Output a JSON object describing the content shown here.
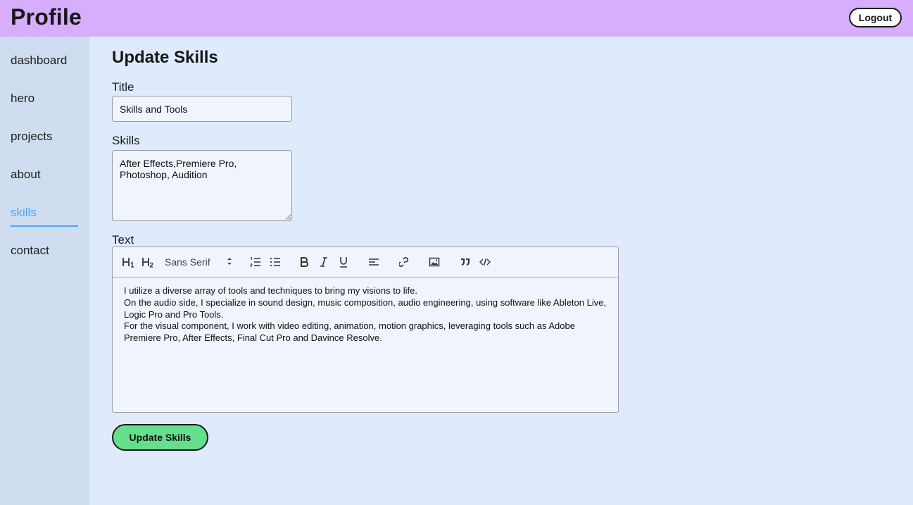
{
  "header": {
    "title": "Profile",
    "logout_label": "Logout"
  },
  "sidebar": {
    "items": [
      {
        "label": "dashboard"
      },
      {
        "label": "hero"
      },
      {
        "label": "projects"
      },
      {
        "label": "about"
      },
      {
        "label": "skills",
        "active": true
      },
      {
        "label": "contact"
      }
    ]
  },
  "form": {
    "heading": "Update Skills",
    "title_label": "Title",
    "title_value": "Skills and Tools",
    "skills_label": "Skills",
    "skills_value": "After Effects,Premiere Pro,\nPhotoshop, Audition",
    "text_label": "Text",
    "editor": {
      "font_select": "Sans Serif",
      "lines": [
        "I utilize a diverse array of tools and techniques to bring my visions to life.",
        "On the audio side, I specialize in sound design, music composition, audio engineering, using software like Ableton Live, Logic Pro and Pro Tools.",
        "For the visual component, I work with video editing, animation, motion graphics, leveraging tools such as Adobe Premiere Pro, After Effects, Final Cut Pro and Davince Resolve."
      ]
    },
    "submit_label": "Update Skills"
  },
  "colors": {
    "header_bg": "#d6aefc",
    "sidebar_bg": "#d0dcf0",
    "page_bg": "#dfeafd",
    "active_nav": "#4aa8ee",
    "submit_bg": "#66df8d"
  },
  "icons": [
    "h1-icon",
    "h2-icon",
    "ordered-list-icon",
    "bullet-list-icon",
    "bold-icon",
    "italic-icon",
    "underline-icon",
    "align-left-icon",
    "link-icon",
    "image-icon",
    "blockquote-icon",
    "code-icon"
  ]
}
